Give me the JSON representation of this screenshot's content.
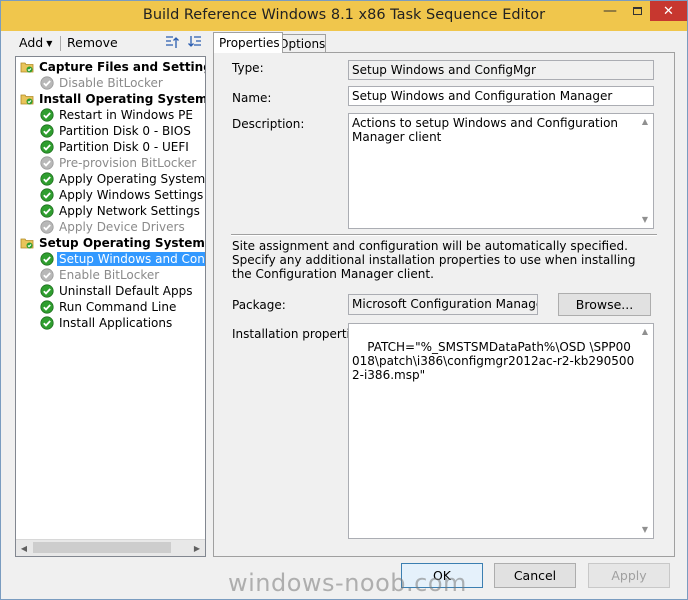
{
  "window": {
    "title": "Build Reference Windows 8.1 x86 Task Sequence Editor",
    "minimize_glyph": "—",
    "close_glyph": "✕"
  },
  "toolbar": {
    "add_label": "Add",
    "add_arrow": "▼",
    "remove_label": "Remove"
  },
  "tree": {
    "items": [
      {
        "label": "Capture Files and Settings",
        "type": "group"
      },
      {
        "label": "Disable BitLocker",
        "type": "disabled"
      },
      {
        "label": "Install Operating System",
        "type": "group"
      },
      {
        "label": "Restart in Windows PE",
        "type": "ok"
      },
      {
        "label": "Partition Disk 0 - BIOS",
        "type": "ok"
      },
      {
        "label": "Partition Disk 0 - UEFI",
        "type": "ok"
      },
      {
        "label": "Pre-provision BitLocker",
        "type": "disabled"
      },
      {
        "label": "Apply Operating System",
        "type": "ok"
      },
      {
        "label": "Apply Windows Settings",
        "type": "ok"
      },
      {
        "label": "Apply Network Settings",
        "type": "ok"
      },
      {
        "label": "Apply Device Drivers",
        "type": "disabled"
      },
      {
        "label": "Setup Operating System",
        "type": "group"
      },
      {
        "label": "Setup Windows and Configura",
        "type": "selected"
      },
      {
        "label": "Enable BitLocker",
        "type": "disabled"
      },
      {
        "label": "Uninstall Default Apps",
        "type": "ok"
      },
      {
        "label": "Run Command Line",
        "type": "ok"
      },
      {
        "label": "Install Applications",
        "type": "ok"
      }
    ],
    "scroll_left": "◀",
    "scroll_right": "▶"
  },
  "tabs": {
    "properties": "Properties",
    "options": "Options"
  },
  "form": {
    "type_label": "Type:",
    "type_value": "Setup Windows and ConfigMgr",
    "name_label": "Name:",
    "name_value": "Setup Windows and Configuration Manager",
    "description_label": "Description:",
    "description_value": "Actions to setup Windows and Configuration Manager client",
    "info_text": "Site assignment and configuration will be automatically specified. Specify any additional installation properties to use when installing the Configuration Manager client.",
    "package_label": "Package:",
    "package_value": "Microsoft Configuration Manager Client",
    "browse_label": "Browse...",
    "install_props_label": "Installation properties:",
    "install_props_value": "PATCH=\"%_SMSTSMDataPath%\\OSD \\SPP00018\\patch\\i386\\configmgr2012ac-r2-kb2905002-i386.msp\"",
    "scroll_up": "▲",
    "scroll_down": "▼"
  },
  "buttons": {
    "ok": "OK",
    "cancel": "Cancel",
    "apply": "Apply"
  },
  "watermark": "windows-noob.com",
  "colors": {
    "titlebar": "#f0c64c",
    "close": "#c7372f",
    "selection": "#3399ff",
    "check_green": "#2f9e2f"
  }
}
